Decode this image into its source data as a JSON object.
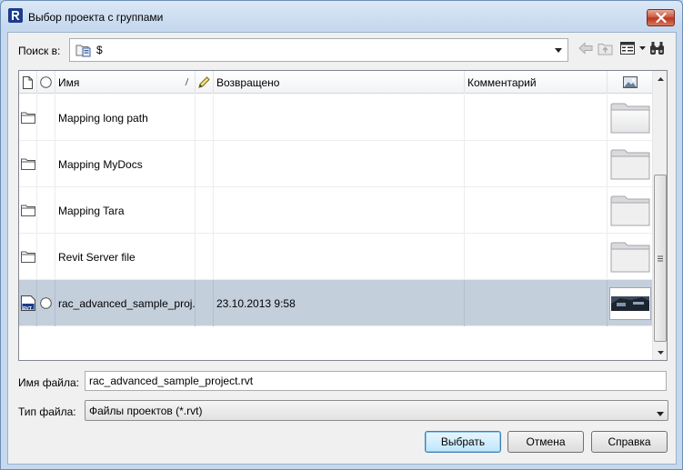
{
  "window": {
    "title": "Выбор проекта с группами"
  },
  "lookin": {
    "label": "Поиск в:",
    "value": "$"
  },
  "columns": {
    "name": "Имя",
    "returned": "Возвращено",
    "comment": "Комментарий"
  },
  "rows": [
    {
      "name": "Mapping long path",
      "returned": "",
      "comment": "",
      "type": "folder"
    },
    {
      "name": "Mapping MyDocs",
      "returned": "",
      "comment": "",
      "type": "folder"
    },
    {
      "name": "Mapping Tara",
      "returned": "",
      "comment": "",
      "type": "folder"
    },
    {
      "name": "Revit Server file",
      "returned": "",
      "comment": "",
      "type": "folder"
    },
    {
      "name": "rac_advanced_sample_proj...",
      "returned": "23.10.2013 9:58",
      "comment": "",
      "type": "rvt",
      "file_icon_text": "RVT"
    }
  ],
  "filename": {
    "label": "Имя файла:",
    "value": "rac_advanced_sample_project.rvt"
  },
  "filetype": {
    "label": "Тип файла:",
    "value": "Файлы проектов (*.rvt)"
  },
  "buttons": {
    "select": "Выбрать",
    "cancel": "Отмена",
    "help": "Справка"
  },
  "colors": {
    "selected_row": "#c4cfdc",
    "close_button": "#c8523c"
  }
}
